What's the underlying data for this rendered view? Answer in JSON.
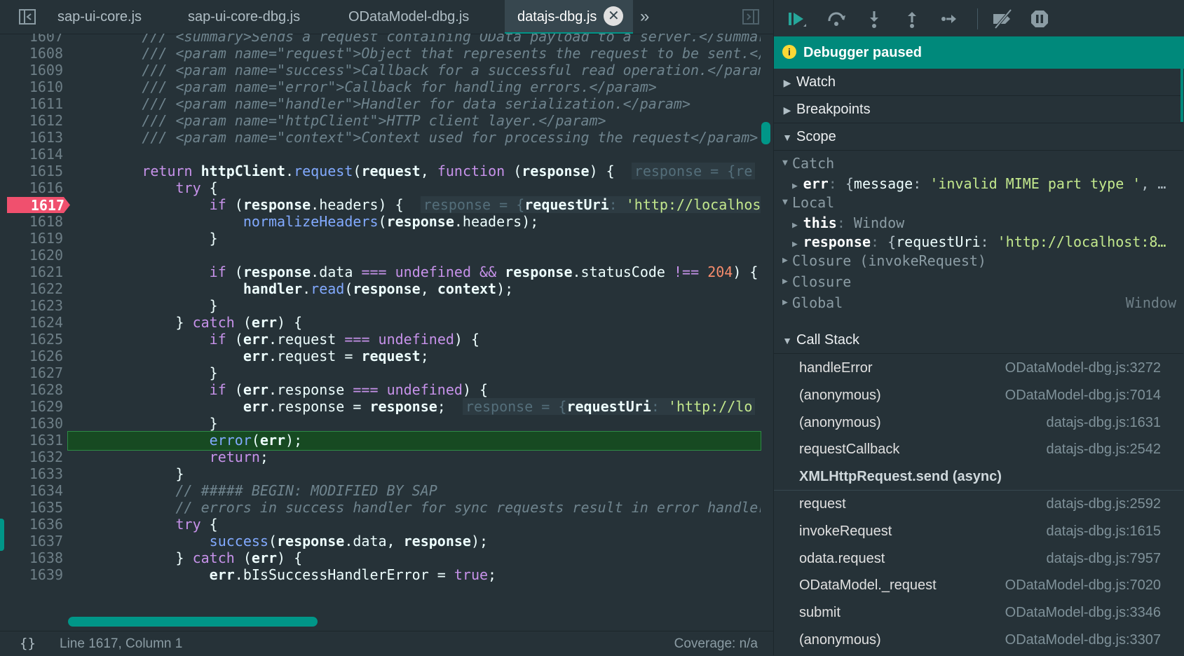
{
  "tabs": {
    "items": [
      "sap-ui-core.js",
      "sap-ui-core-dbg.js",
      "ODataModel-dbg.js",
      "datajs-dbg.js"
    ],
    "active_index": 3,
    "close_icon": "close-icon",
    "more_icon": "chevrons-right-icon"
  },
  "code": {
    "execution_line": 1631,
    "breakpoint_line": 1617,
    "lines": [
      {
        "n": "1607",
        "t": "        /// <summary>Sends a request containing OData payload to a server.</summary>",
        "cls": "cm"
      },
      {
        "n": "1608",
        "t": "        /// <param name=\"request\">Object that represents the request to be sent.</param>",
        "cls": "cm"
      },
      {
        "n": "1609",
        "t": "        /// <param name=\"success\">Callback for a successful read operation.</param>",
        "cls": "cm"
      },
      {
        "n": "1610",
        "t": "        /// <param name=\"error\">Callback for handling errors.</param>",
        "cls": "cm"
      },
      {
        "n": "1611",
        "t": "        /// <param name=\"handler\">Handler for data serialization.</param>",
        "cls": "cm"
      },
      {
        "n": "1612",
        "t": "        /// <param name=\"httpClient\">HTTP client layer.</param>",
        "cls": "cm"
      },
      {
        "n": "1613",
        "t": "        /// <param name=\"context\">Context used for processing the request</param>",
        "cls": "cm"
      },
      {
        "n": "1614",
        "t": ""
      },
      {
        "n": "1615",
        "t": "        return httpClient.request(request, function (response) {",
        "inline": "response = {re"
      },
      {
        "n": "1616",
        "t": "            try {"
      },
      {
        "n": "1617",
        "t": "                if (response.headers) {",
        "inline": "response = {requestUri: 'http://localhost"
      },
      {
        "n": "1618",
        "t": "                    normalizeHeaders(response.headers);"
      },
      {
        "n": "1619",
        "t": "                }"
      },
      {
        "n": "1620",
        "t": ""
      },
      {
        "n": "1621",
        "t": "                if (response.data === undefined && response.statusCode !== 204) {"
      },
      {
        "n": "1622",
        "t": "                    handler.read(response, context);"
      },
      {
        "n": "1623",
        "t": "                }"
      },
      {
        "n": "1624",
        "t": "            } catch (err) {"
      },
      {
        "n": "1625",
        "t": "                if (err.request === undefined) {"
      },
      {
        "n": "1626",
        "t": "                    err.request = request;"
      },
      {
        "n": "1627",
        "t": "                }"
      },
      {
        "n": "1628",
        "t": "                if (err.response === undefined) {"
      },
      {
        "n": "1629",
        "t": "                    err.response = response;",
        "inline": "response = {requestUri: 'http://lo"
      },
      {
        "n": "1630",
        "t": "                }"
      },
      {
        "n": "1631",
        "t": "                error(err);"
      },
      {
        "n": "1632",
        "t": "                return;"
      },
      {
        "n": "1633",
        "t": "            }"
      },
      {
        "n": "1634",
        "t": "            // ##### BEGIN: MODIFIED BY SAP",
        "cls": "cm"
      },
      {
        "n": "1635",
        "t": "            // errors in success handler for sync requests result in error handler calls",
        "cls": "cm"
      },
      {
        "n": "1636",
        "t": "            try {"
      },
      {
        "n": "1637",
        "t": "                success(response.data, response);"
      },
      {
        "n": "1638",
        "t": "            } catch (err) {"
      },
      {
        "n": "1639",
        "t": "                err.bIsSuccessHandlerError = true;"
      }
    ]
  },
  "status": {
    "format_icon": "{}",
    "position": "Line 1617, Column 1",
    "coverage": "Coverage: n/a"
  },
  "debugger": {
    "toolbar": [
      "resume-icon",
      "step-over-icon",
      "step-into-icon",
      "step-out-icon",
      "step-icon",
      "deactivate-breakpoints-icon",
      "pause-on-exceptions-icon"
    ],
    "paused_label": "Debugger paused",
    "sections": {
      "watch": "Watch",
      "breakpoints": "Breakpoints",
      "scope": "Scope",
      "call_stack": "Call Stack"
    },
    "scope": [
      {
        "kind": "group",
        "label": "Catch",
        "open": true
      },
      {
        "kind": "var",
        "name": "err",
        "sep": ": ",
        "value": "{message: 'invalid MIME part type ', …"
      },
      {
        "kind": "group",
        "label": "Local",
        "open": true
      },
      {
        "kind": "var",
        "name": "this",
        "sep": ": ",
        "value": "Window"
      },
      {
        "kind": "var",
        "name": "response",
        "sep": ": ",
        "value": "{requestUri: 'http://localhost:8…"
      },
      {
        "kind": "group",
        "label": "Closure (invokeRequest)",
        "open": false
      },
      {
        "kind": "group",
        "label": "Closure",
        "open": false
      },
      {
        "kind": "group",
        "label": "Global",
        "open": false,
        "right": "Window"
      }
    ],
    "call_stack": [
      {
        "fn": "handleError",
        "loc": "ODataModel-dbg.js:3272"
      },
      {
        "fn": "(anonymous)",
        "loc": "ODataModel-dbg.js:7014"
      },
      {
        "fn": "(anonymous)",
        "loc": "datajs-dbg.js:1631"
      },
      {
        "fn": "requestCallback",
        "loc": "datajs-dbg.js:2542"
      },
      {
        "fn": "XMLHttpRequest.send (async)",
        "loc": "",
        "async": true
      },
      {
        "fn": "request",
        "loc": "datajs-dbg.js:2592"
      },
      {
        "fn": "invokeRequest",
        "loc": "datajs-dbg.js:1615"
      },
      {
        "fn": "odata.request",
        "loc": "datajs-dbg.js:7957"
      },
      {
        "fn": "ODataModel._request",
        "loc": "ODataModel-dbg.js:7020"
      },
      {
        "fn": "submit",
        "loc": "ODataModel-dbg.js:3346"
      },
      {
        "fn": "(anonymous)",
        "loc": "ODataModel-dbg.js:3307"
      }
    ]
  },
  "colors": {
    "accent": "#009688",
    "paused_banner": "#00897b",
    "breakpoint": "#f0506e",
    "exec_line": "#174a22",
    "background": "#263238"
  }
}
